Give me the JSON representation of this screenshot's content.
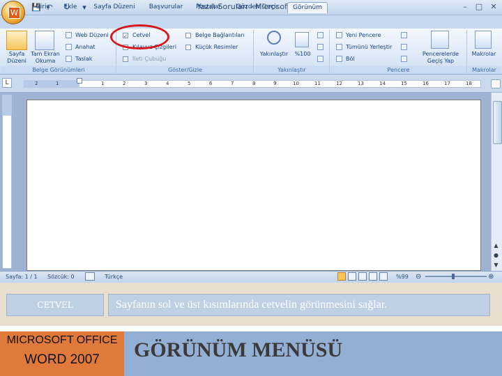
{
  "window": {
    "title": "Yazılı Soruları - Microsoft Word",
    "minimize": "–",
    "maximize": "□",
    "close": "✕",
    "office_logo": "W"
  },
  "quick_access": {
    "save": "💾",
    "undo": "↶",
    "redo": "↻",
    "more": "▾"
  },
  "tabs": [
    "Giriş",
    "Ekle",
    "Sayfa Düzeni",
    "Başvurular",
    "Postalar",
    "Gözden Geçir",
    "Görünüm"
  ],
  "active_tab": "Görünüm",
  "ribbon": {
    "belge_gorunumleri": {
      "label": "Belge Görünümleri",
      "sayfa_duzeni": "Sayfa Düzeni",
      "tam_ekran": "Tam Ekran Okuma",
      "web_duzeni": "Web Düzeni",
      "anahat": "Anahat",
      "taslak": "Taslak"
    },
    "goster_gizle": {
      "label": "Göster/Gizle",
      "cetvel": "Cetvel",
      "cetvel_checked": "✓",
      "kilavuz": "Kılavuz Çizgileri",
      "ileti": "İleti Çubuğu",
      "belge_baglantilari": "Belge Bağlantıları",
      "kucuk_resimler": "Küçük Resimler"
    },
    "yakinlastir": {
      "label": "Yakınlaştır",
      "yakinlastir": "Yakınlaştır",
      "yuzde": "%100"
    },
    "pencere": {
      "label": "Pencere",
      "yeni": "Yeni Pencere",
      "tumunu": "Tümünü Yerleştir",
      "bol": "Böl",
      "gecis": "Pencerelerde Geçiş Yap"
    },
    "makrolar": {
      "label": "Makrolar",
      "makrolar": "Makrolar"
    }
  },
  "ruler": {
    "corner": "L",
    "ticks": [
      "2",
      "1",
      "1",
      "2",
      "3",
      "4",
      "5",
      "6",
      "7",
      "8",
      "9",
      "10",
      "11",
      "12",
      "13",
      "14",
      "15",
      "16",
      "17",
      "18"
    ]
  },
  "statusbar": {
    "sayfa": "Sayfa: 1 / 1",
    "sozcuk": "Sözcük: 0",
    "dil": "Türkçe",
    "zoom": "%99",
    "minus": "⊖",
    "plus": "⊕"
  },
  "slide": {
    "term": "CETVEL",
    "description": "Sayfanın sol ve üst kısımlarında cetvelin görünmesini sağlar.",
    "brand_line1": "MICROSOFT OFFICE",
    "brand_line2": "WORD 2007",
    "menu_title": "GÖRÜNÜM MENÜSÜ"
  },
  "colors": {
    "highlight_circle": "#d8161c",
    "brand_box": "#e07a3a",
    "menu_title_box": "#93afd3",
    "note_box": "#bfd0e4",
    "ribbon_text": "#15428b"
  }
}
